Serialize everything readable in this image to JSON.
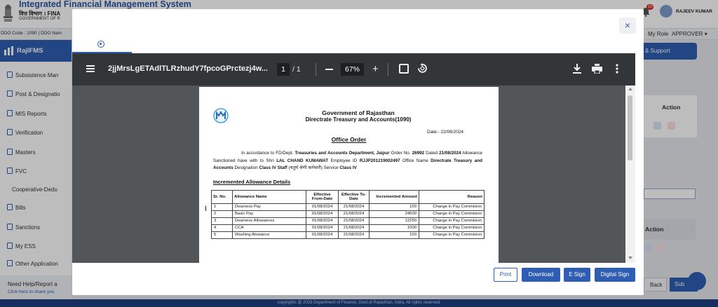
{
  "header": {
    "app_title": "Integrated Financial Management System",
    "dept": "वित्त विभाग । FINA",
    "gov": "GOVERNMENT OF R",
    "notification_count": "10",
    "user_name": "RAJEEV KUMAR"
  },
  "infobar": {
    "ddo": "DDO Code : 1090 | DDO Nam",
    "role_label": "My Role",
    "role_value": "APPROVER"
  },
  "sidebar": {
    "brand": "RajIFMS",
    "items": [
      {
        "label": "Subsistence Man"
      },
      {
        "label": "Post & Designatio"
      },
      {
        "label": "MIS Reports"
      },
      {
        "label": "Verification"
      },
      {
        "label": "Masters"
      },
      {
        "label": "FVC"
      },
      {
        "label": "Cooperative-Dedu"
      },
      {
        "label": "Bills"
      },
      {
        "label": "Sanctions"
      },
      {
        "label": "My ESS"
      },
      {
        "label": "Other Application"
      }
    ],
    "help_title": "Need Help/Report a",
    "help_sub": "Click here to share you"
  },
  "background": {
    "support_label": "& Support",
    "action_label_1": "Action",
    "action_label_2": "Action",
    "back_label": "Back",
    "submit_label": "Sub"
  },
  "footer": {
    "text": "copyrights @ 2023 Department of Finance, Govt.of Rajasthan, India, All rights reserved."
  },
  "modal": {
    "close_symbol": "×",
    "viewer": {
      "file_name": "2jjMrsLgETAdlTLRzhudY7fpcoGPrctezj4w...",
      "current_page": "1",
      "total_pages": "/  1",
      "zoom": "67%"
    },
    "doc": {
      "heading1": "Government of Rajasthan",
      "heading2": "Directrate Treasury and Accounts(1090)",
      "date": "Date:- 22/08/2024",
      "title": "Office Order",
      "para": {
        "p1": "In accordance to FD/Dept. ",
        "dept": "Treasuries and Accounts Department, Jaipur",
        "p2": " Order No. ",
        "order_no": "26992",
        "p3": " Dated ",
        "dated": "21/08/2024",
        "p4": " Allowance Sanctioned have with to Shri ",
        "shri": "LAL CHAND KUMAWAT",
        "p5": "  Employee ID ",
        "emp_id": "RJJP201219002497",
        "p6": " Office Name ",
        "office": "Directrate Treasury and Accounts",
        "p7": " Designation ",
        "designation": "Class IV Staff",
        "designation_hi": " (चतुर्थ श्रेणी कर्मचारी)",
        "p8": " Service ",
        "service": "Class IV"
      },
      "section_title": "Incremented Allowance Details",
      "table": {
        "headers": [
          "Sr. No.",
          "Allowance Name",
          "Effective From-Date",
          "Effective To-Date",
          "Incremented Amount",
          "Reason"
        ],
        "rows": [
          [
            "1",
            "Dearness Pay",
            "01/08/2024",
            "21/08/2024",
            "100",
            "Change in Pay Commision"
          ],
          [
            "2",
            "Basic Pay",
            "01/08/2024",
            "21/08/2024",
            "24500",
            "Change in Pay Commision"
          ],
          [
            "3",
            "Dearness Allowances",
            "01/08/2024",
            "21/08/2024",
            "12250",
            "Change in Pay Commision"
          ],
          [
            "4",
            "CCA",
            "01/08/2024",
            "21/08/2024",
            "1000",
            "Change in Pay Commision"
          ],
          [
            "5",
            "Washing Alowance",
            "01/08/2024",
            "21/08/2024",
            "150",
            "Change in Pay Commision"
          ]
        ]
      }
    },
    "buttons": {
      "print": "Print",
      "download": "Download",
      "esign": "E Sign",
      "digital_sign": "Digital Sign"
    }
  },
  "colors": {
    "primary": "#2f5db1",
    "header_title": "#2c56a5",
    "viewer_bg": "#525659",
    "viewer_toolbar": "#323639"
  }
}
